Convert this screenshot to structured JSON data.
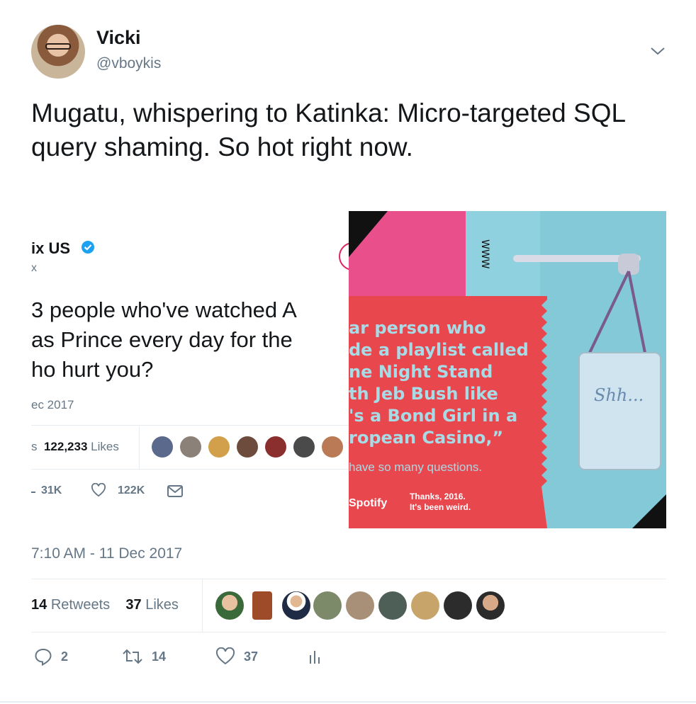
{
  "author": {
    "name": "Vicki",
    "handle": "@vboykis"
  },
  "tweet": {
    "text": "Mugatu, whispering to Katinka: Micro-targeted SQL query shaming. So hot right now."
  },
  "quoted": {
    "name": "ix US",
    "handle": "x",
    "lines": [
      "3 people who've watched A",
      "as Prince every day for the",
      "ho hurt you?"
    ],
    "date": "ec 2017",
    "likes_prefix": "s",
    "likes_count": "122,233",
    "likes_label": "Likes",
    "retweets": "31K",
    "likes": "122K"
  },
  "spotify": {
    "lines": [
      "ar person who",
      "de a playlist called",
      "ne Night Stand",
      "th Jeb Bush like",
      "'s a Bond Girl in a",
      "ropean Casino,”"
    ],
    "question": "have so many questions.",
    "logo": "Spotify",
    "thanks_line1": "Thanks, 2016.",
    "thanks_line2": "It's been weird.",
    "sign": "Shh..."
  },
  "timestamp": "7:10 AM - 11 Dec 2017",
  "stats": {
    "retweets_count": "14",
    "retweets_label": "Retweets",
    "likes_count": "37",
    "likes_label": "Likes"
  },
  "actions": {
    "replies": "2",
    "retweets": "14",
    "likes": "37"
  },
  "icons": {
    "reply": "reply-icon",
    "retweet": "retweet-icon",
    "like": "heart-icon",
    "analytics": "analytics-icon",
    "more": "chevron-down-icon"
  },
  "colors": {
    "text": "#14171a",
    "secondary": "#657786",
    "divider": "#e6ecf0",
    "verified": "#1da1f2"
  }
}
